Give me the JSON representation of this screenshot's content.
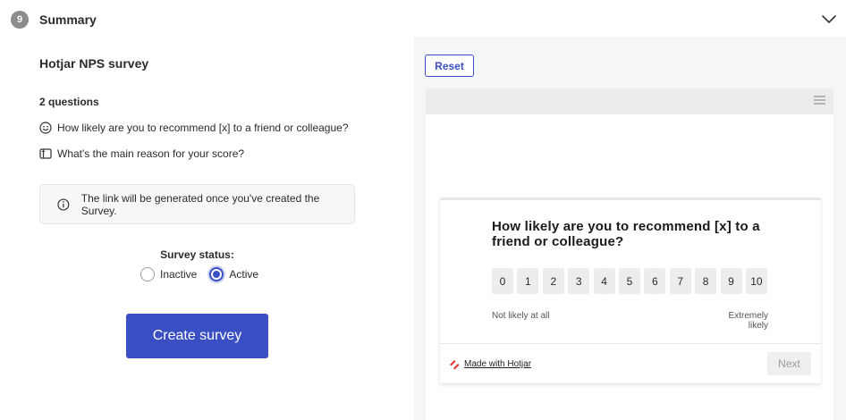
{
  "header": {
    "step_number": "9",
    "title": "Summary"
  },
  "summary": {
    "survey_name": "Hotjar NPS survey",
    "questions_count": "2 questions",
    "questions": [
      {
        "icon": "smiley-face-icon",
        "text": "How likely are you to recommend [x] to a friend or colleague?"
      },
      {
        "icon": "long-text-icon",
        "text": "What's the main reason for your score?"
      }
    ],
    "info_text": "The link will be generated once you've created the Survey.",
    "status_label": "Survey status:",
    "status_options": [
      {
        "label": "Inactive",
        "selected": false
      },
      {
        "label": "Active",
        "selected": true
      }
    ],
    "create_button": "Create survey"
  },
  "preview": {
    "reset_button": "Reset",
    "question": "How likely are you to recommend [x] to a friend or colleague?",
    "scale": [
      "0",
      "1",
      "2",
      "3",
      "4",
      "5",
      "6",
      "7",
      "8",
      "9",
      "10"
    ],
    "scale_low_label": "Not likely at all",
    "scale_high_label": "Extremely likely",
    "branding": "Made with Hotjar",
    "next_button": "Next"
  },
  "colors": {
    "accent": "#3a4fc3",
    "badge": "#8c8c8c",
    "hotjar_logo": "#e5322d"
  }
}
